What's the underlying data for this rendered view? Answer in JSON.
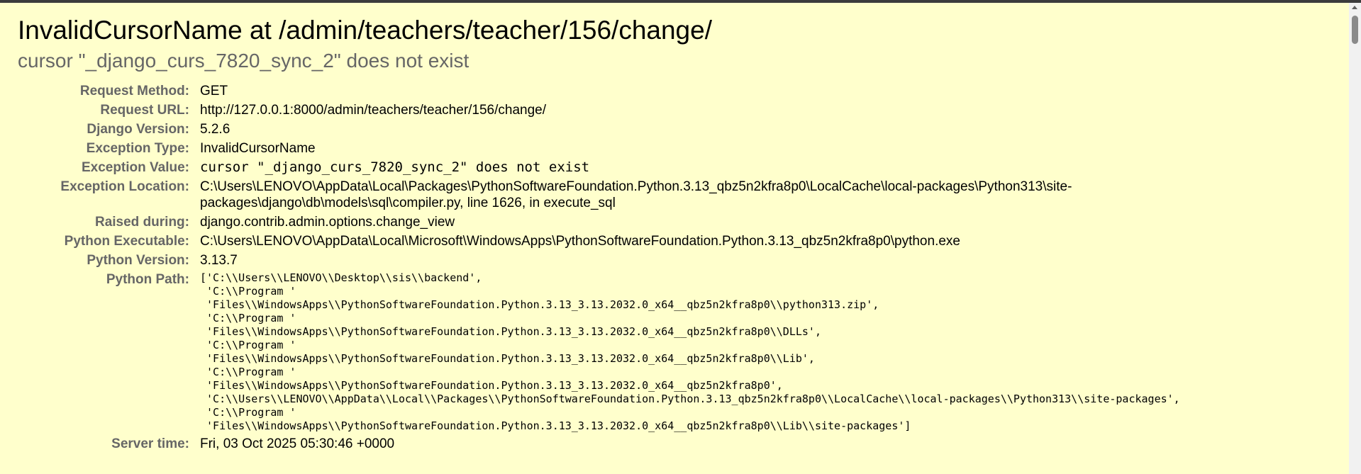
{
  "title": "InvalidCursorName at /admin/teachers/teacher/156/change/",
  "subtitle": "cursor \"_django_curs_7820_sync_2\" does not exist",
  "meta": {
    "request_method": {
      "label": "Request Method:",
      "value": "GET"
    },
    "request_url": {
      "label": "Request URL:",
      "value": "http://127.0.0.1:8000/admin/teachers/teacher/156/change/"
    },
    "django_version": {
      "label": "Django Version:",
      "value": "5.2.6"
    },
    "exception_type": {
      "label": "Exception Type:",
      "value": "InvalidCursorName"
    },
    "exception_value": {
      "label": "Exception Value:",
      "value": "cursor \"_django_curs_7820_sync_2\" does not exist"
    },
    "exception_location": {
      "label": "Exception Location:",
      "value": "C:\\Users\\LENOVO\\AppData\\Local\\Packages\\PythonSoftwareFoundation.Python.3.13_qbz5n2kfra8p0\\LocalCache\\local-packages\\Python313\\site-packages\\django\\db\\models\\sql\\compiler.py, line 1626, in execute_sql"
    },
    "raised_during": {
      "label": "Raised during:",
      "value": "django.contrib.admin.options.change_view"
    },
    "python_executable": {
      "label": "Python Executable:",
      "value": "C:\\Users\\LENOVO\\AppData\\Local\\Microsoft\\WindowsApps\\PythonSoftwareFoundation.Python.3.13_qbz5n2kfra8p0\\python.exe"
    },
    "python_version": {
      "label": "Python Version:",
      "value": "3.13.7"
    },
    "python_path": {
      "label": "Python Path:",
      "lines": [
        "['C:\\\\Users\\\\LENOVO\\\\Desktop\\\\sis\\\\backend',",
        " 'C:\\\\Program '",
        " 'Files\\\\WindowsApps\\\\PythonSoftwareFoundation.Python.3.13_3.13.2032.0_x64__qbz5n2kfra8p0\\\\python313.zip',",
        " 'C:\\\\Program '",
        " 'Files\\\\WindowsApps\\\\PythonSoftwareFoundation.Python.3.13_3.13.2032.0_x64__qbz5n2kfra8p0\\\\DLLs',",
        " 'C:\\\\Program '",
        " 'Files\\\\WindowsApps\\\\PythonSoftwareFoundation.Python.3.13_3.13.2032.0_x64__qbz5n2kfra8p0\\\\Lib',",
        " 'C:\\\\Program '",
        " 'Files\\\\WindowsApps\\\\PythonSoftwareFoundation.Python.3.13_3.13.2032.0_x64__qbz5n2kfra8p0',",
        " 'C:\\\\Users\\\\LENOVO\\\\AppData\\\\Local\\\\Packages\\\\PythonSoftwareFoundation.Python.3.13_qbz5n2kfra8p0\\\\LocalCache\\\\local-packages\\\\Python313\\\\site-packages',",
        " 'C:\\\\Program '",
        " 'Files\\\\WindowsApps\\\\PythonSoftwareFoundation.Python.3.13_3.13.2032.0_x64__qbz5n2kfra8p0\\\\Lib\\\\site-packages']"
      ]
    },
    "server_time": {
      "label": "Server time:",
      "value": "Fri, 03 Oct 2025 05:30:46 +0000"
    }
  },
  "colors": {
    "background": "#ffffcc",
    "label": "#666666",
    "text": "#000000"
  },
  "icons": {
    "scroll_arrow": "scroll-up-arrow-icon"
  }
}
